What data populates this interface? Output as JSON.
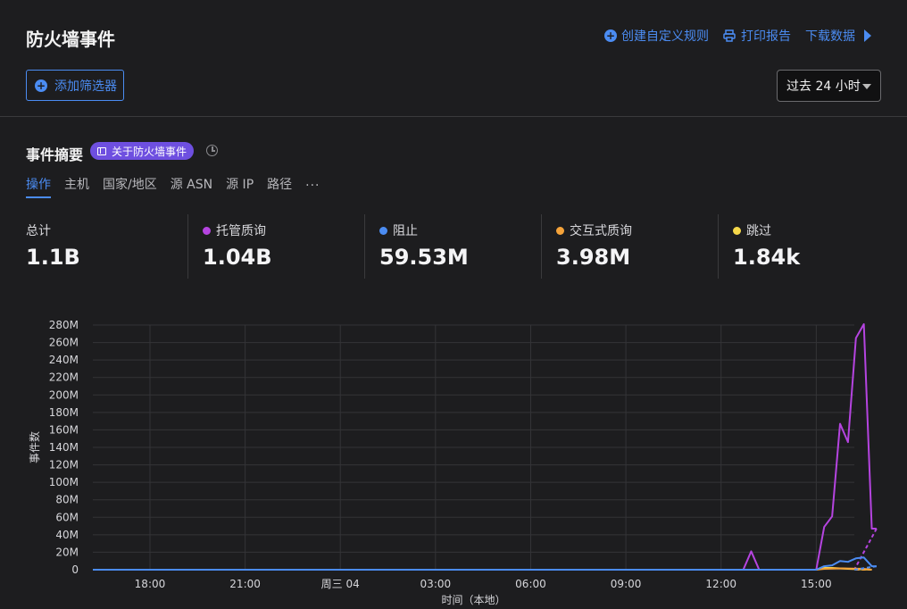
{
  "header": {
    "title": "防火墙事件",
    "actions": {
      "create_rule": "创建自定义规则",
      "print_report": "打印报告",
      "download_data": "下载数据"
    },
    "add_filter": "添加筛选器",
    "time_range": "过去 24 小时",
    "accent_color": "#4b8cf2"
  },
  "summary": {
    "title": "事件摘要",
    "about_badge": "关于防火墙事件",
    "tabs": [
      "操作",
      "主机",
      "国家/地区",
      "源 ASN",
      "源 IP",
      "路径",
      "..."
    ],
    "active_tab": 0,
    "stats": [
      {
        "label": "总计",
        "value": "1.1B",
        "color": ""
      },
      {
        "label": "托管质询",
        "value": "1.04B",
        "color": "#b544e0"
      },
      {
        "label": "阻止",
        "value": "59.53M",
        "color": "#4b8cf2"
      },
      {
        "label": "交互式质询",
        "value": "3.98M",
        "color": "#f5a33a"
      },
      {
        "label": "跳过",
        "value": "1.84k",
        "color": "#f5d84a"
      }
    ]
  },
  "chart_data": {
    "type": "line",
    "xlabel": "时间（本地）",
    "ylabel": "事件数",
    "y_ticks": [
      "0",
      "20M",
      "40M",
      "60M",
      "80M",
      "100M",
      "120M",
      "140M",
      "160M",
      "180M",
      "200M",
      "220M",
      "240M",
      "260M",
      "280M"
    ],
    "ylim": [
      0,
      280
    ],
    "y_unit": "M",
    "x_ticks": [
      {
        "hour": 1,
        "label": "18:00"
      },
      {
        "hour": 4,
        "label": "21:00"
      },
      {
        "hour": 7,
        "label": "周三 04"
      },
      {
        "hour": 10,
        "label": "03:00"
      },
      {
        "hour": 13,
        "label": "06:00"
      },
      {
        "hour": 16,
        "label": "09:00"
      },
      {
        "hour": 19,
        "label": "12:00"
      },
      {
        "hour": 22,
        "label": "15:00"
      }
    ],
    "xlim": [
      -0.8,
      23.2
    ],
    "grid": true,
    "series": [
      {
        "name": "托管质询",
        "color": "#b544e0",
        "points": [
          [
            -0.8,
            0
          ],
          [
            19.7,
            0
          ],
          [
            19.95,
            21
          ],
          [
            20.2,
            0
          ],
          [
            22.0,
            0
          ],
          [
            22.25,
            49
          ],
          [
            22.5,
            61
          ],
          [
            22.75,
            167
          ],
          [
            23.0,
            146
          ],
          [
            23.25,
            265
          ],
          [
            23.5,
            281
          ],
          [
            23.75,
            47
          ],
          [
            23.9,
            47
          ],
          [
            24.2,
            0
          ]
        ]
      },
      {
        "name": "阻止",
        "color": "#4b8cf2",
        "points": [
          [
            -0.8,
            0
          ],
          [
            22.0,
            0
          ],
          [
            22.25,
            4
          ],
          [
            22.5,
            5
          ],
          [
            22.75,
            10
          ],
          [
            23.0,
            9
          ],
          [
            23.25,
            13
          ],
          [
            23.5,
            14
          ],
          [
            23.75,
            4
          ],
          [
            23.9,
            4
          ],
          [
            24.2,
            0
          ]
        ]
      },
      {
        "name": "交互式质询",
        "color": "#f5a33a",
        "points": [
          [
            -0.8,
            0
          ],
          [
            22.0,
            0
          ],
          [
            22.25,
            1
          ],
          [
            22.75,
            1.5
          ],
          [
            23.5,
            1
          ],
          [
            23.75,
            0
          ],
          [
            24.2,
            0
          ]
        ]
      },
      {
        "name": "跳过",
        "color": "#f5d84a",
        "points": [
          [
            -0.8,
            0
          ],
          [
            22.0,
            0
          ],
          [
            22.25,
            2
          ],
          [
            22.5,
            2
          ],
          [
            22.75,
            1.5
          ],
          [
            23.0,
            1
          ],
          [
            23.75,
            0
          ],
          [
            24.2,
            0
          ]
        ]
      }
    ]
  }
}
